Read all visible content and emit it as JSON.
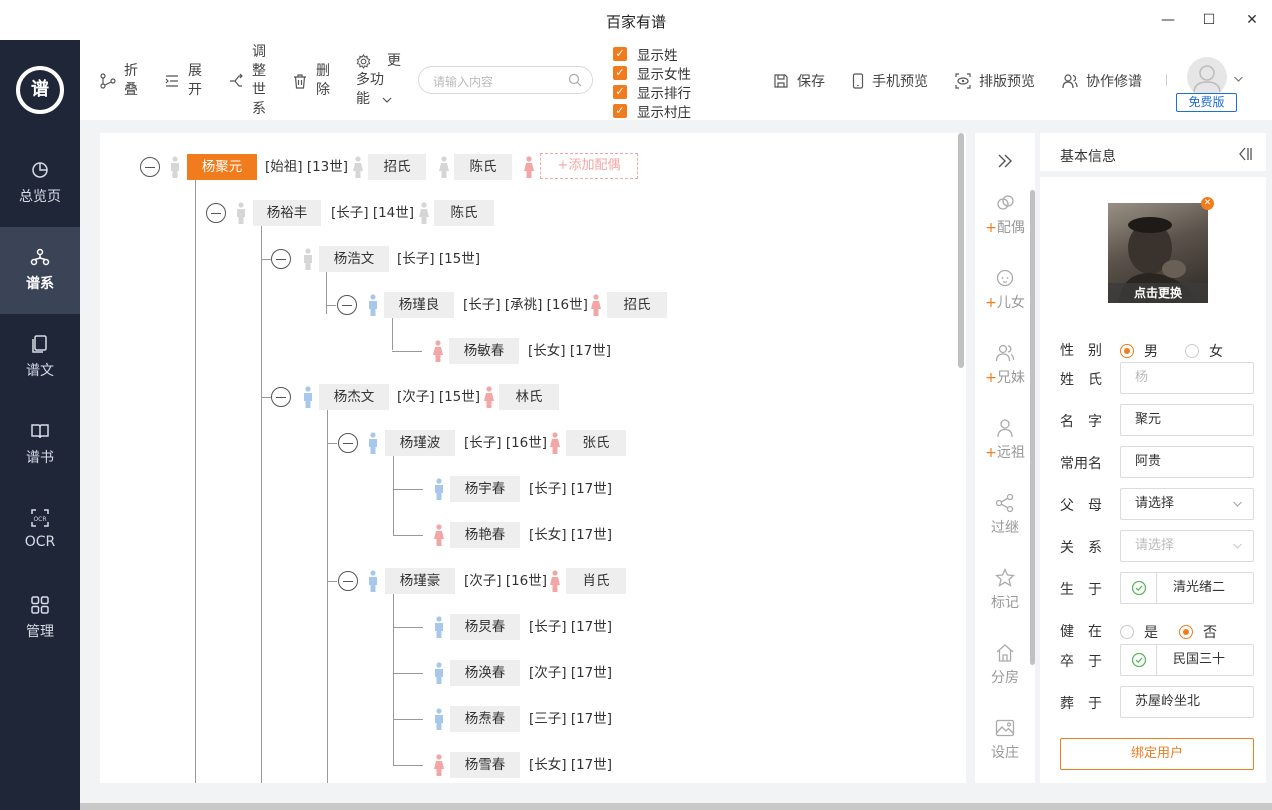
{
  "window": {
    "title": "百家有谱",
    "minimize": "—",
    "maximize": "☐",
    "close": "✕"
  },
  "sidebar": {
    "logo": "谱",
    "items": [
      {
        "label": "总览页",
        "icon": "pie-chart-icon"
      },
      {
        "label": "谱系",
        "icon": "tree-icon",
        "active": true
      },
      {
        "label": "谱文",
        "icon": "document-icon"
      },
      {
        "label": "谱书",
        "icon": "book-icon"
      },
      {
        "label": "OCR",
        "icon": "ocr-icon"
      },
      {
        "label": "管理",
        "icon": "grid-icon"
      }
    ]
  },
  "toolbar": {
    "collapse": [
      "折",
      "叠"
    ],
    "expand": [
      "展",
      "开"
    ],
    "adjust": [
      "调",
      "整",
      "世",
      "系"
    ],
    "delete": [
      "删",
      "除"
    ],
    "more": [
      "更",
      "多功",
      "能"
    ],
    "search_placeholder": "请输入内容",
    "checks": [
      "显示姓",
      "显示女性",
      "显示排行",
      "显示村庄"
    ],
    "save": "保存",
    "mobile_preview": "手机预览",
    "layout_preview": "排版预览",
    "collab": "协作修谱",
    "free_badge": "免费版"
  },
  "tree": {
    "root": {
      "name": "杨聚元",
      "info": "[始祖] [13世]",
      "spouses": [
        "招氏",
        "陈氏"
      ],
      "add_spouse": "+添加配偶"
    },
    "n1": {
      "name": "杨裕丰",
      "info": "[长子] [14世]",
      "spouse": "陈氏"
    },
    "n2": {
      "name": "杨浩文",
      "info": "[长子] [15世]"
    },
    "n3": {
      "name": "杨瑾良",
      "info": "[长子] [承祧] [16世]",
      "spouse": "招氏"
    },
    "n4": {
      "name": "杨敏春",
      "info": "[长女] [17世]"
    },
    "n5": {
      "name": "杨杰文",
      "info": "[次子] [15世]",
      "spouse": "林氏"
    },
    "n6": {
      "name": "杨瑾波",
      "info": "[长子] [16世]",
      "spouse": "张氏"
    },
    "n7": {
      "name": "杨宇春",
      "info": "[长子] [17世]"
    },
    "n8": {
      "name": "杨艳春",
      "info": "[长女] [17世]"
    },
    "n9": {
      "name": "杨瑾豪",
      "info": "[次子] [16世]",
      "spouse": "肖氏"
    },
    "n10": {
      "name": "杨炅春",
      "info": "[长子] [17世]"
    },
    "n11": {
      "name": "杨涣春",
      "info": "[次子] [17世]"
    },
    "n12": {
      "name": "杨焘春",
      "info": "[三子] [17世]"
    },
    "n13": {
      "name": "杨雪春",
      "info": "[长女] [17世]"
    }
  },
  "sidetools": {
    "spouse": [
      "+",
      "配偶"
    ],
    "children": [
      "+",
      "儿女"
    ],
    "siblings": [
      "+",
      "兄妹"
    ],
    "ancestor": [
      "+",
      "远祖"
    ],
    "adopt": "过继",
    "mark": "标记",
    "branch": "分房",
    "set_ancestor": "设庄"
  },
  "panel": {
    "title": "基本信息",
    "photo_change": "点击更换",
    "gender_label": "性　别",
    "male": "男",
    "female": "女",
    "surname_label": "姓　氏",
    "surname_placeholder": "杨",
    "name_label": "名　字",
    "name_value": "聚元",
    "common_name_label": "常用名",
    "common_name_value": "阿贵",
    "parents_label": "父　母",
    "parents_placeholder": "请选择",
    "relation_label": "关　系",
    "relation_placeholder": "请选择",
    "born_label": "生　于",
    "born_value": "清光绪二",
    "alive_label": "健　在",
    "alive_yes": "是",
    "alive_no": "否",
    "died_label": "卒　于",
    "died_value": "民国三十",
    "buried_label": "葬　于",
    "buried_value": "苏屋岭坐北",
    "bind_user": "绑定用户"
  }
}
